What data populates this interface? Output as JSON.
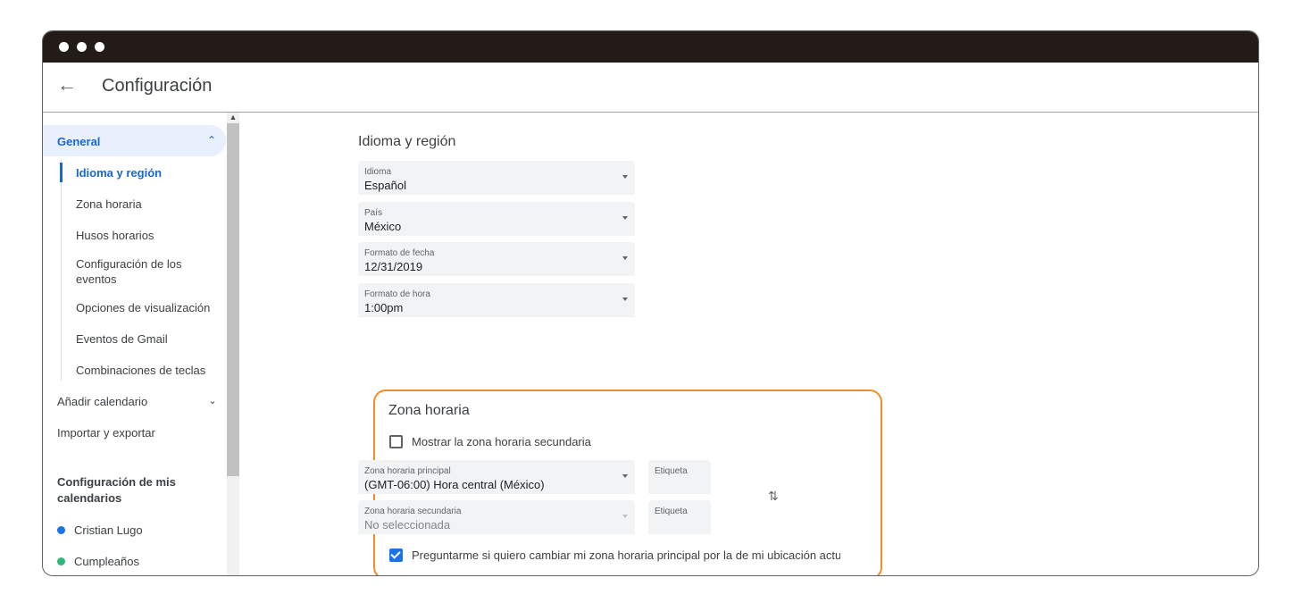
{
  "window": {
    "title": "Configuración"
  },
  "sidebar": {
    "general_label": "General",
    "sub_items": [
      "Idioma y región",
      "Zona horaria",
      "Husos horarios",
      "Configuración de los eventos",
      "Opciones de visualización",
      "Eventos de Gmail",
      "Combinaciones de teclas"
    ],
    "add_calendar": "Añadir calendario",
    "import_export": "Importar y exportar",
    "my_calendars_heading": "Configuración de mis calendarios",
    "calendars": [
      {
        "name": "Cristian Lugo",
        "color": "#1a73e8"
      },
      {
        "name": "Cumpleaños",
        "color": "#33b679"
      }
    ]
  },
  "language_region": {
    "heading": "Idioma y región",
    "fields": [
      {
        "label": "Idioma",
        "value": "Español"
      },
      {
        "label": "País",
        "value": "México"
      },
      {
        "label": "Formato de fecha",
        "value": "12/31/2019"
      },
      {
        "label": "Formato de hora",
        "value": "1:00pm"
      }
    ]
  },
  "timezone": {
    "heading": "Zona horaria",
    "show_secondary_label": "Mostrar la zona horaria secundaria",
    "show_secondary_checked": false,
    "primary_label": "Zona horaria principal",
    "primary_value": "(GMT-06:00) Hora central (México)",
    "primary_tag_placeholder": "Etiqueta",
    "secondary_label": "Zona horaria secundaria",
    "secondary_value": "No seleccionada",
    "secondary_tag_placeholder": "Etiqueta",
    "ask_change_label": "Preguntarme si quiero cambiar mi zona horaria principal por la de mi ubicación actual",
    "ask_change_checked": true
  },
  "colors": {
    "accent": "#1967d2",
    "highlight": "#f28c28",
    "titlebar": "#221b17"
  }
}
